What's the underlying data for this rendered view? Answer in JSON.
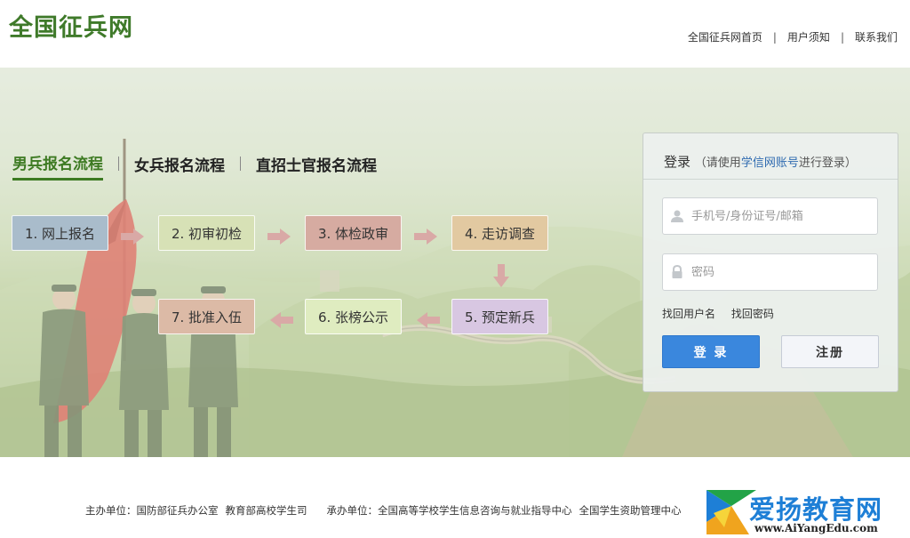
{
  "header": {
    "logo": "全国征兵网",
    "nav": [
      "全国征兵网首页",
      "用户须知",
      "联系我们"
    ],
    "nav_separator": "|"
  },
  "tabs": [
    "男兵报名流程",
    "女兵报名流程",
    "直招士官报名流程"
  ],
  "active_tab": 0,
  "steps": [
    {
      "label": "1. 网上报名",
      "color": "#a9bccb"
    },
    {
      "label": "2. 初审初检",
      "color": "#d7e1b6"
    },
    {
      "label": "3. 体检政审",
      "color": "#d6aba1"
    },
    {
      "label": "4. 走访调查",
      "color": "#e2c9a1"
    },
    {
      "label": "5. 预定新兵",
      "color": "#d8c7e2"
    },
    {
      "label": "6. 张榜公示",
      "color": "#dfecc0"
    },
    {
      "label": "7. 批准入伍",
      "color": "#dcbaa6"
    }
  ],
  "arrow_color": "#d9a9a6",
  "login": {
    "title": "登录",
    "hint_prefix": "（请使用",
    "hint_link": "学信网账号",
    "hint_suffix": "进行登录）",
    "username_placeholder": "手机号/身份证号/邮箱",
    "password_placeholder": "密码",
    "link_find_username": "找回用户名",
    "link_find_password": "找回密码",
    "login_button": "登 录",
    "register_button": "注册"
  },
  "footer": {
    "host_label": "主办单位：国防部征兵办公室",
    "host_label_2": "教育部高校学生司",
    "organizer_label": "承办单位：全国高等学校学生信息咨询与就业指导中心",
    "organizer_label_2": "全国学生资助管理中心"
  },
  "watermark": {
    "text": "爱扬教育网",
    "url": "www.AiYangEdu.com"
  }
}
